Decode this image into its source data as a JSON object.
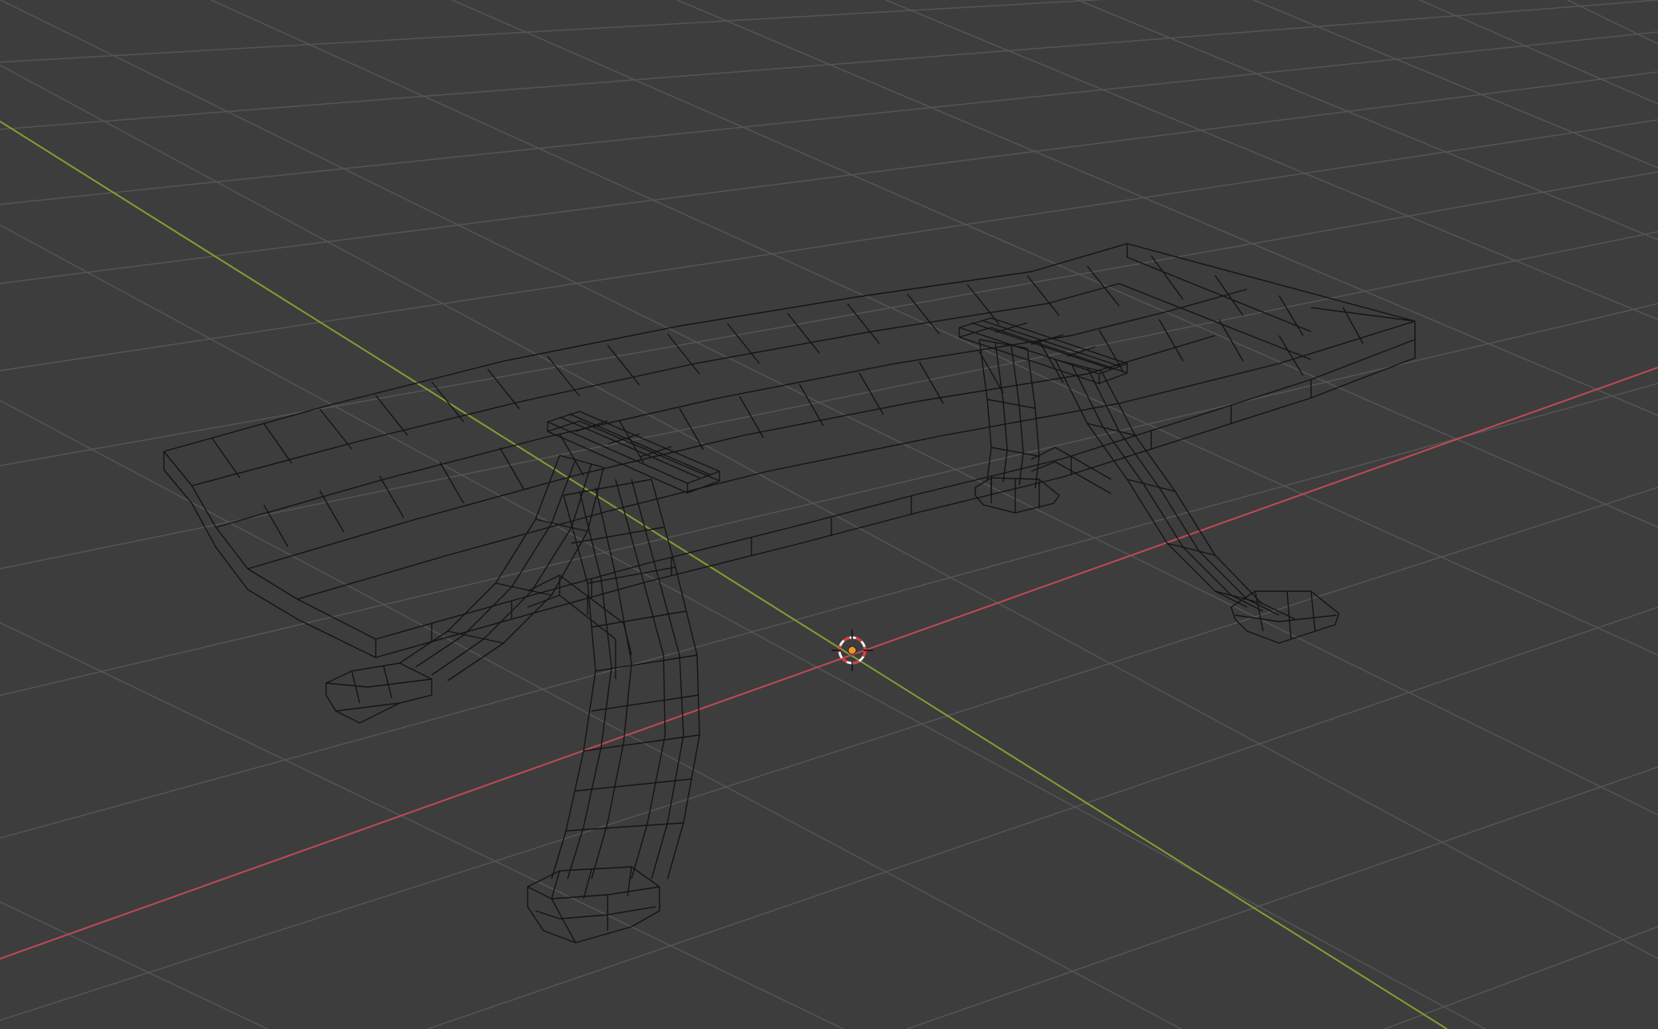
{
  "app": {
    "view": "3D Viewport",
    "shading": "wireframe"
  },
  "colors": {
    "background": "#3d3d3d",
    "grid_line": "#5a5a5a",
    "grid_line_far": "#4b4b4b",
    "x_axis": "#b24a55",
    "y_axis": "#6f9a2f",
    "wire": "#1a1a1a",
    "cursor_ring_red": "#e0383e",
    "cursor_ring_white": "#f2f2f2",
    "cursor_center": "#f0962a"
  },
  "icons": {
    "cursor": "3d-cursor-icon",
    "origin": "object-origin-icon"
  },
  "objects": [
    {
      "name": "table",
      "type": "mesh",
      "parts": [
        "tabletop",
        "front-left-leg",
        "back-left-leg",
        "front-right-leg",
        "back-right-leg",
        "left-leg-crossbar",
        "right-leg-crossbar"
      ]
    }
  ]
}
